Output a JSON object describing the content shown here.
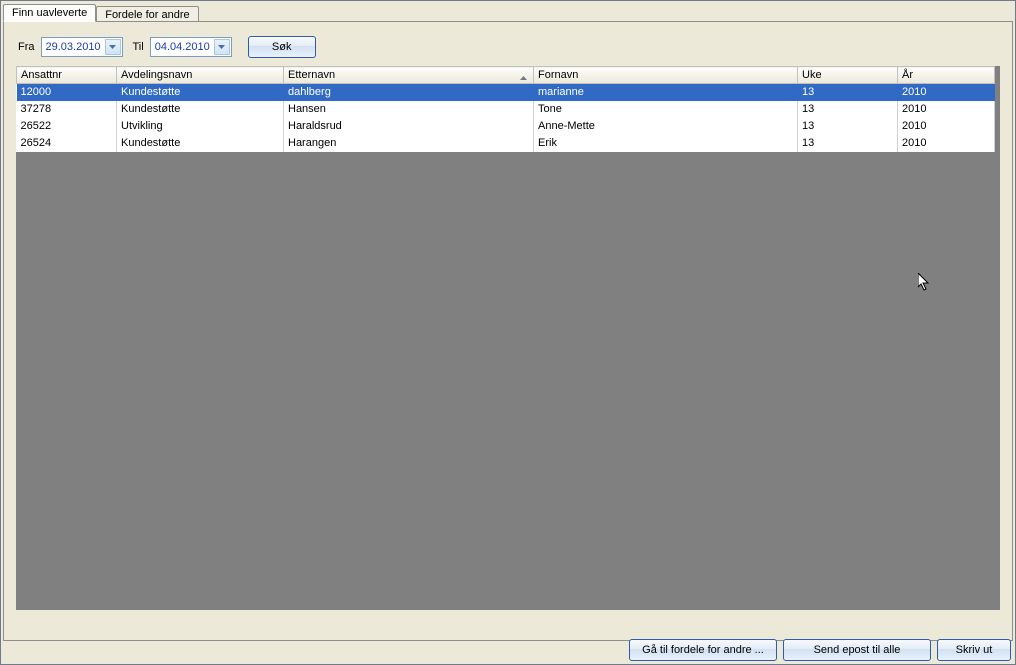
{
  "tabs": {
    "finn": "Finn uavleverte",
    "fordele": "Fordele for andre"
  },
  "filter": {
    "fra_label": "Fra",
    "til_label": "Til",
    "fra_value": "29.03.2010",
    "til_value": "04.04.2010",
    "sok_label": "Søk"
  },
  "columns": {
    "ansatt": "Ansattnr",
    "avd": "Avdelingsnavn",
    "etter": "Etternavn",
    "forn": "Fornavn",
    "uke": "Uke",
    "ar": "År"
  },
  "rows": [
    {
      "ansatt": "12000",
      "avd": "Kundestøtte",
      "etter": "dahlberg",
      "forn": "marianne",
      "uke": "13",
      "ar": "2010",
      "selected": true
    },
    {
      "ansatt": "37278",
      "avd": "Kundestøtte",
      "etter": "Hansen",
      "forn": "Tone",
      "uke": "13",
      "ar": "2010",
      "selected": false
    },
    {
      "ansatt": "26522",
      "avd": "Utvikling",
      "etter": "Haraldsrud",
      "forn": "Anne-Mette",
      "uke": "13",
      "ar": "2010",
      "selected": false
    },
    {
      "ansatt": "26524",
      "avd": "Kundestøtte",
      "etter": "Harangen",
      "forn": "Erik",
      "uke": "13",
      "ar": "2010",
      "selected": false
    }
  ],
  "buttons": {
    "ga_til": "Gå til fordele for andre ...",
    "send_epost": "Send epost til alle",
    "skriv_ut": "Skriv ut"
  }
}
